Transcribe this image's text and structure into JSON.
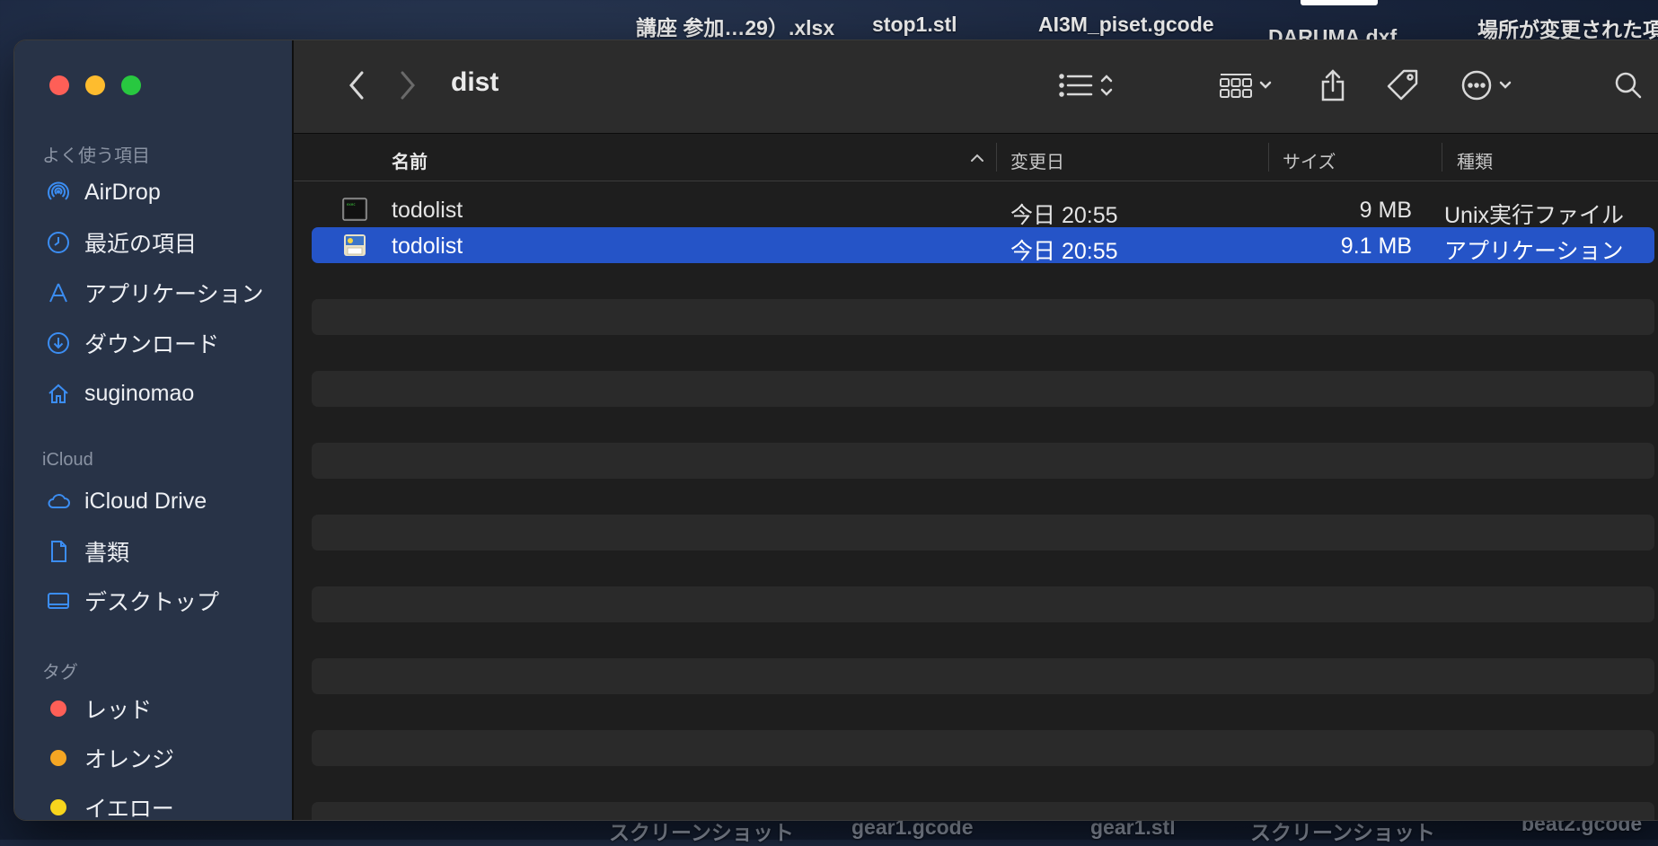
{
  "desktop": {
    "labels_top": [
      "講座 参加…29）.xlsx",
      "stop1.stl",
      "AI3M_piset.gcode",
      "DARUMA.dxf",
      "場所が変更された項"
    ],
    "labels_bottom": [
      "スクリーンショット",
      "gear1.gcode",
      "gear1.stl",
      "スクリーンショット",
      "beat2.gcode"
    ]
  },
  "window": {
    "title": "dist",
    "traffic_lights": [
      "close",
      "minimize",
      "zoom"
    ]
  },
  "sidebar": {
    "favorites_header": "よく使う項目",
    "favorites": [
      {
        "label": "AirDrop",
        "icon": "airdrop-icon"
      },
      {
        "label": "最近の項目",
        "icon": "clock-icon"
      },
      {
        "label": "アプリケーション",
        "icon": "applications-icon"
      },
      {
        "label": "ダウンロード",
        "icon": "download-icon"
      },
      {
        "label": "suginomao",
        "icon": "home-icon"
      }
    ],
    "icloud_header": "iCloud",
    "icloud": [
      {
        "label": "iCloud Drive",
        "icon": "cloud-icon"
      },
      {
        "label": "書類",
        "icon": "document-icon"
      },
      {
        "label": "デスクトップ",
        "icon": "desktop-icon"
      }
    ],
    "tags_header": "タグ",
    "tags": [
      {
        "label": "レッド",
        "color": "#fe5f57"
      },
      {
        "label": "オレンジ",
        "color": "#f5a623"
      },
      {
        "label": "イエロー",
        "color": "#f7d51d"
      }
    ]
  },
  "toolbar": {
    "icons": [
      "back-icon",
      "forward-icon",
      "list-view-icon",
      "group-icon",
      "share-icon",
      "tag-icon",
      "more-icon",
      "search-icon"
    ]
  },
  "columns": {
    "name": "名前",
    "modified": "変更日",
    "size": "サイズ",
    "kind": "種類"
  },
  "files": [
    {
      "name": "todolist",
      "modified": "今日 20:55",
      "size": "9 MB",
      "kind": "Unix実行ファイル",
      "icon": "terminal-exec-icon",
      "selected": false
    },
    {
      "name": "todolist",
      "modified": "今日 20:55",
      "size": "9.1 MB",
      "kind": "アプリケーション",
      "icon": "app-icon",
      "selected": true
    }
  ],
  "colors": {
    "selection": "#2554c7",
    "sidebar_bg": "#283347",
    "accent_icon": "#3b8df2"
  }
}
